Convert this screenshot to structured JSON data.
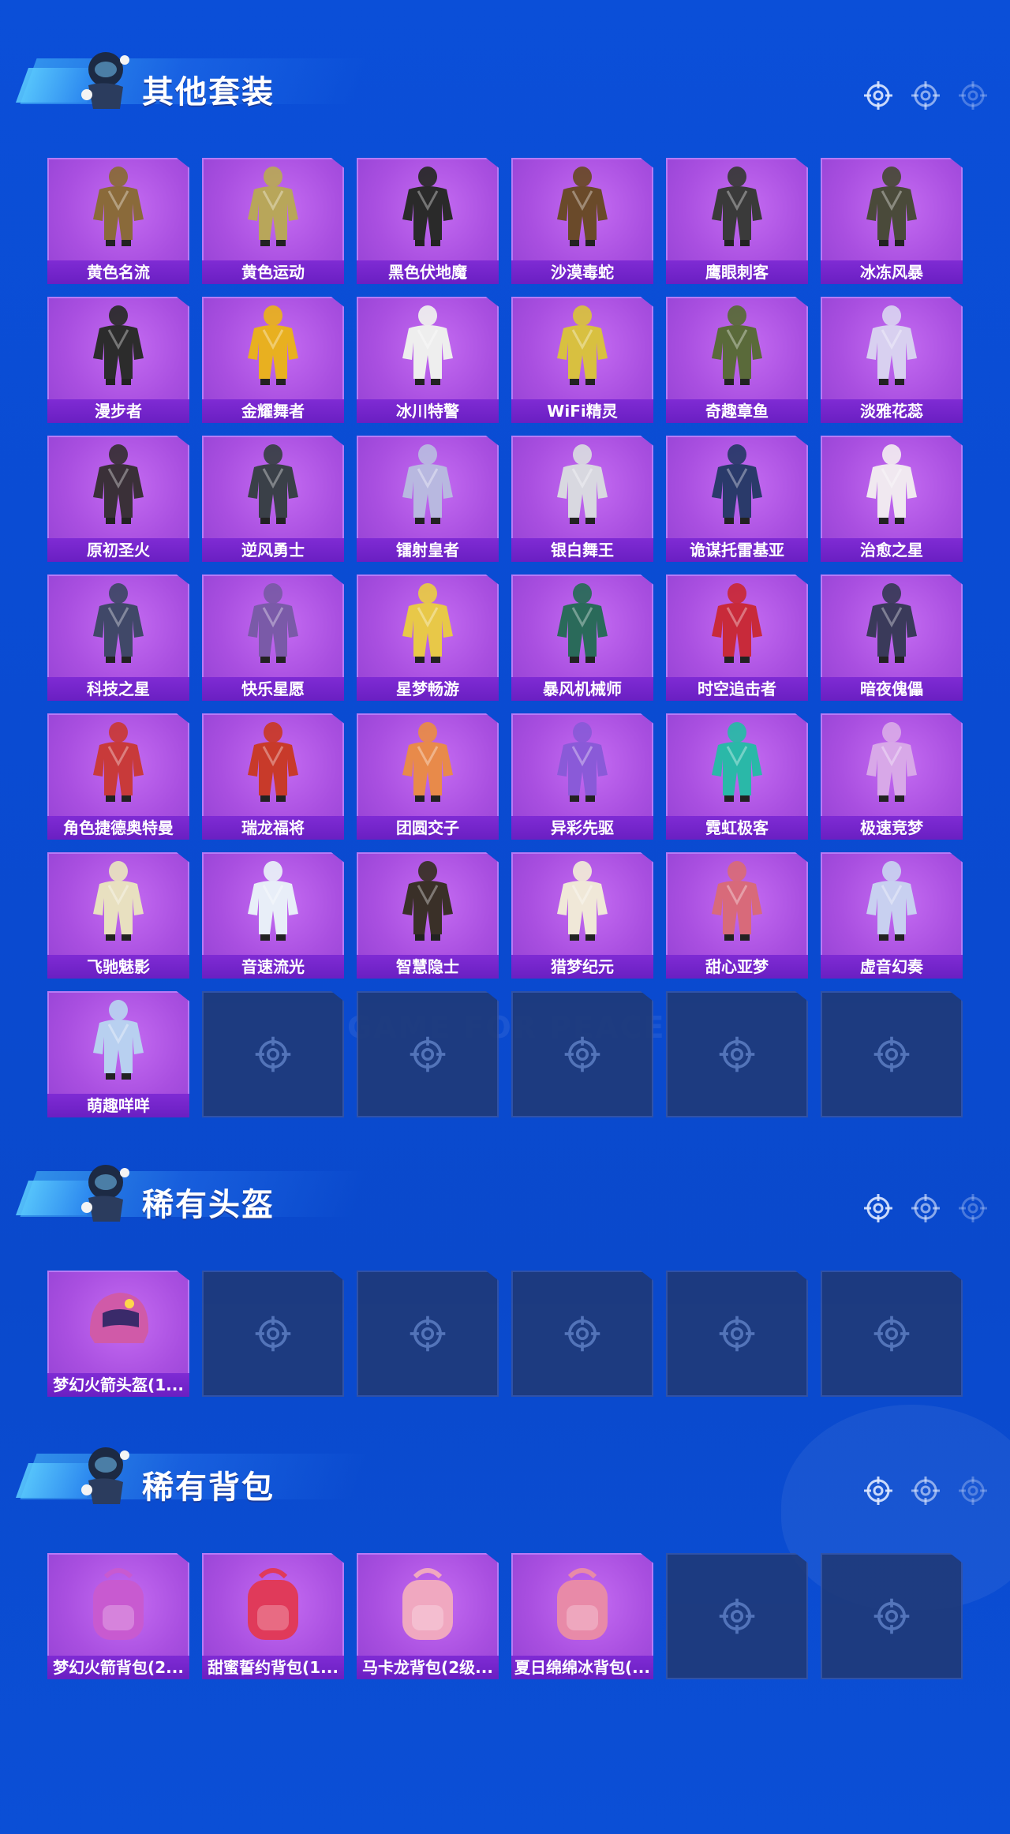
{
  "sections": [
    {
      "title": "其他套装",
      "items": [
        {
          "label": "黄色名流",
          "color": "#8a6a3a"
        },
        {
          "label": "黄色运动",
          "color": "#b8a65a"
        },
        {
          "label": "黑色伏地魔",
          "color": "#2a2a2a"
        },
        {
          "label": "沙漠毒蛇",
          "color": "#6a4a2a"
        },
        {
          "label": "鹰眼刺客",
          "color": "#3a3a3a"
        },
        {
          "label": "冰冻风暴",
          "color": "#4a4a3a"
        },
        {
          "label": "漫步者",
          "color": "#2c2c2c"
        },
        {
          "label": "金耀舞者",
          "color": "#e8b020"
        },
        {
          "label": "冰川特警",
          "color": "#eeeeee"
        },
        {
          "label": "WiFi精灵",
          "color": "#d8c040"
        },
        {
          "label": "奇趣章鱼",
          "color": "#5a6a3a"
        },
        {
          "label": "淡雅花蕊",
          "color": "#d8d0f0"
        },
        {
          "label": "原初圣火",
          "color": "#3a3038"
        },
        {
          "label": "逆风勇士",
          "color": "#3a4048"
        },
        {
          "label": "镭射皇者",
          "color": "#b8b8e0"
        },
        {
          "label": "银白舞王",
          "color": "#d8d8e0"
        },
        {
          "label": "诡谋托雷基亚",
          "color": "#2a3a6a"
        },
        {
          "label": "治愈之星",
          "color": "#f0e8f0"
        },
        {
          "label": "科技之星",
          "color": "#404868"
        },
        {
          "label": "快乐星愿",
          "color": "#7a5aa8"
        },
        {
          "label": "星梦畅游",
          "color": "#e8c848"
        },
        {
          "label": "暴风机械师",
          "color": "#2a6a5a"
        },
        {
          "label": "时空追击者",
          "color": "#c82a3a"
        },
        {
          "label": "暗夜傀儡",
          "color": "#3a3a5a"
        },
        {
          "label": "角色捷德奥特曼",
          "color": "#c83a3a"
        },
        {
          "label": "瑞龙福将",
          "color": "#c83a2a"
        },
        {
          "label": "团圆交子",
          "color": "#e88a4a"
        },
        {
          "label": "异彩先驱",
          "color": "#8a5ad8"
        },
        {
          "label": "霓虹极客",
          "color": "#2ab8a8"
        },
        {
          "label": "极速竞梦",
          "color": "#d8a8e8"
        },
        {
          "label": "飞驰魅影",
          "color": "#e8e0c0"
        },
        {
          "label": "音速流光",
          "color": "#e8eef8"
        },
        {
          "label": "智慧隐士",
          "color": "#3a3028"
        },
        {
          "label": "猎梦纪元",
          "color": "#f0e8d8"
        },
        {
          "label": "甜心亚梦",
          "color": "#d86a7a"
        },
        {
          "label": "虚音幻奏",
          "color": "#c8d0f0"
        },
        {
          "label": "萌趣咩咩",
          "color": "#b8d0f0"
        }
      ],
      "empty_slots": 5
    },
    {
      "title": "稀有头盔",
      "items": [
        {
          "label": "梦幻火箭头盔(1...",
          "color": "#d05aa8"
        }
      ],
      "empty_slots": 5
    },
    {
      "title": "稀有背包",
      "items": [
        {
          "label": "梦幻火箭背包(2...",
          "color": "#c85ad0"
        },
        {
          "label": "甜蜜誓约背包(1...",
          "color": "#e03a5a"
        },
        {
          "label": "马卡龙背包(2级...",
          "color": "#f0a8c0"
        },
        {
          "label": "夏日绵绵冰背包(...",
          "color": "#e88aa8"
        }
      ],
      "empty_slots": 2
    }
  ],
  "watermark": "GAME FOR PEACE",
  "header_icon": "crosshair-icon",
  "empty_icon": "crosshair-icon"
}
